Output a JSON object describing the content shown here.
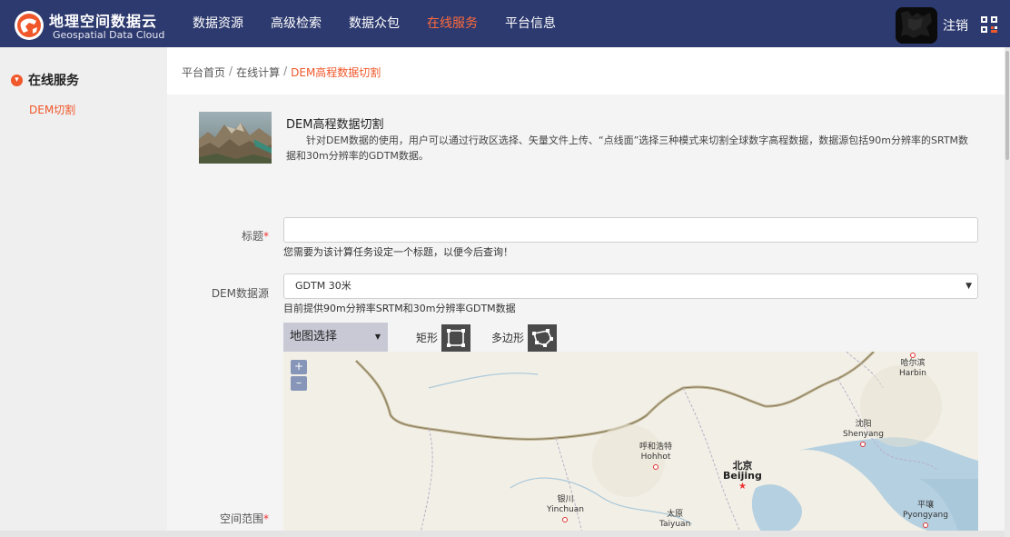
{
  "header": {
    "logo_title": "地理空间数据云",
    "logo_subtitle": "Geospatial Data Cloud",
    "nav": [
      {
        "label": "数据资源"
      },
      {
        "label": "高级检索"
      },
      {
        "label": "数据众包"
      },
      {
        "label": "在线服务",
        "active": true
      },
      {
        "label": "平台信息"
      }
    ],
    "logout": "注销",
    "accent": "#ff6a3d",
    "bar_color": "#2d3a6f"
  },
  "sidebar": {
    "title": "在线服务",
    "items": [
      {
        "label": "DEM切割",
        "active": true
      }
    ]
  },
  "breadcrumb": {
    "items": [
      "平台首页",
      "在线计算",
      "DEM高程数据切割"
    ],
    "separator": "/"
  },
  "intro": {
    "title": "DEM高程数据切割",
    "description": "针对DEM数据的使用，用户可以通过行政区选择、矢量文件上传、“点线面”选择三种模式来切割全球数字高程数据，数据源包括90m分辨率的SRTM数据和30m分辨率的GDTM数据。"
  },
  "form": {
    "title_label": "标题",
    "title_value": "",
    "title_hint": "您需要为该计算任务设定一个标题，以便今后查询！",
    "source_label": "DEM数据源",
    "source_value": "GDTM 30米",
    "source_hint": "目前提供90m分辨率SRTM和30m分辨率GDTM数据",
    "mode_value": "地图选择",
    "rect_label": "矩形",
    "polygon_label": "多边形",
    "extent_label": "空间范围",
    "required_mark": "*"
  },
  "map": {
    "zoom_in": "+",
    "zoom_out": "–",
    "cities": [
      {
        "cn": "哈尔滨",
        "en": "Harbin"
      },
      {
        "cn": "沈阳",
        "en": "Shenyang"
      },
      {
        "cn": "呼和浩特",
        "en": "Hohhot"
      },
      {
        "cn": "北京",
        "en": "Beijing"
      },
      {
        "cn": "银川",
        "en": "Yinchuan"
      },
      {
        "cn": "太原",
        "en": "Taiyuan"
      },
      {
        "cn": "平壤",
        "en": "Pyongyang"
      }
    ]
  }
}
